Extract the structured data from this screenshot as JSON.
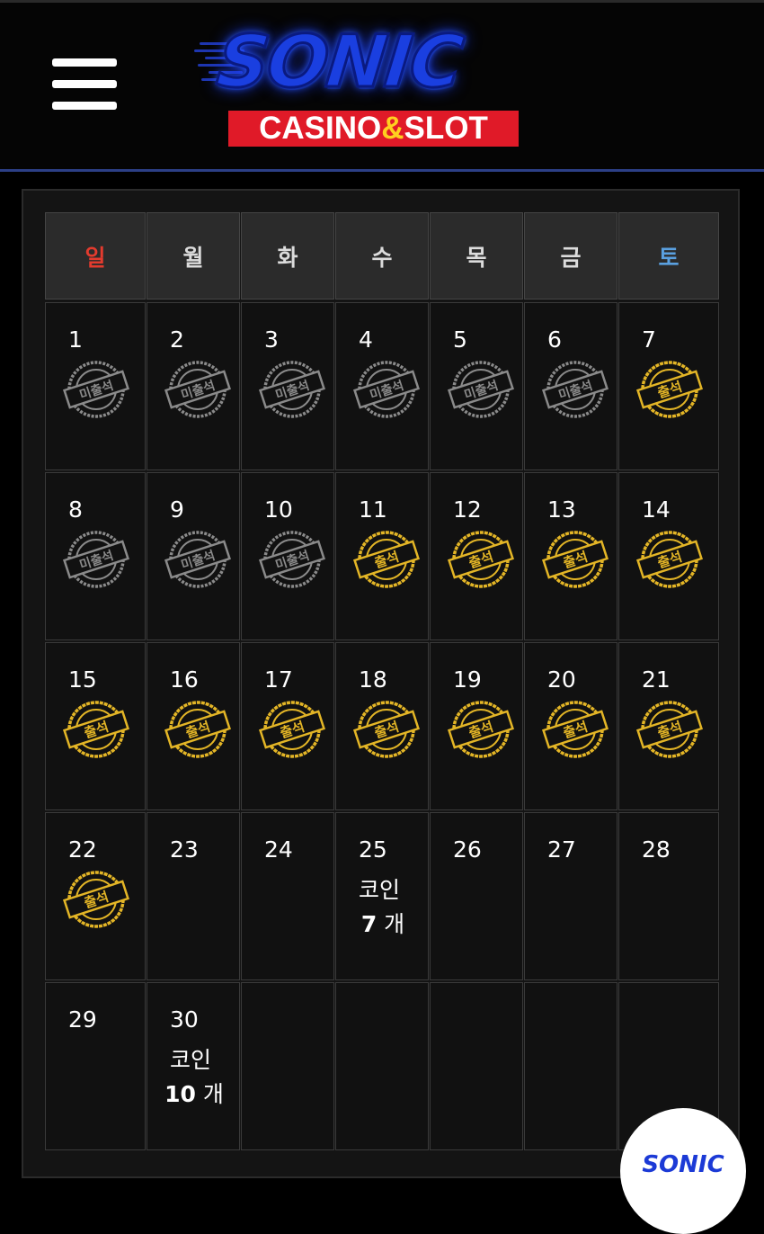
{
  "header": {
    "logo_title": "SONIC",
    "logo_sub_left": "CASINO",
    "logo_sub_amp": "&",
    "logo_sub_right": "SLOT"
  },
  "calendar": {
    "weekdays": [
      "일",
      "월",
      "화",
      "수",
      "목",
      "금",
      "토"
    ],
    "weeks": [
      [
        {
          "day": "1",
          "stamp": "미출석"
        },
        {
          "day": "2",
          "stamp": "미출석"
        },
        {
          "day": "3",
          "stamp": "미출석"
        },
        {
          "day": "4",
          "stamp": "미출석"
        },
        {
          "day": "5",
          "stamp": "미출석"
        },
        {
          "day": "6",
          "stamp": "미출석"
        },
        {
          "day": "7",
          "stamp": "출석"
        }
      ],
      [
        {
          "day": "8",
          "stamp": "미출석"
        },
        {
          "day": "9",
          "stamp": "미출석"
        },
        {
          "day": "10",
          "stamp": "미출석"
        },
        {
          "day": "11",
          "stamp": "출석"
        },
        {
          "day": "12",
          "stamp": "출석"
        },
        {
          "day": "13",
          "stamp": "출석"
        },
        {
          "day": "14",
          "stamp": "출석"
        }
      ],
      [
        {
          "day": "15",
          "stamp": "출석"
        },
        {
          "day": "16",
          "stamp": "출석"
        },
        {
          "day": "17",
          "stamp": "출석"
        },
        {
          "day": "18",
          "stamp": "출석"
        },
        {
          "day": "19",
          "stamp": "출석"
        },
        {
          "day": "20",
          "stamp": "출석"
        },
        {
          "day": "21",
          "stamp": "출석"
        }
      ],
      [
        {
          "day": "22",
          "stamp": "출석"
        },
        {
          "day": "23"
        },
        {
          "day": "24"
        },
        {
          "day": "25",
          "coin_label": "코인",
          "coin_count": "7",
          "coin_unit": "개"
        },
        {
          "day": "26"
        },
        {
          "day": "27"
        },
        {
          "day": "28"
        }
      ],
      [
        {
          "day": "29"
        },
        {
          "day": "30",
          "coin_label": "코인",
          "coin_count": "10",
          "coin_unit": "개"
        },
        {
          "day": ""
        },
        {
          "day": ""
        },
        {
          "day": ""
        },
        {
          "day": ""
        },
        {
          "day": ""
        }
      ]
    ]
  },
  "fab": {
    "label": "SONIC"
  },
  "colors": {
    "attended": "#e3b526",
    "absent": "#8a8a8a",
    "sunday": "#e33b2e",
    "saturday": "#5aa0e0",
    "logo_blue": "#1a3fe0",
    "logo_red": "#e01a28"
  },
  "icons": {
    "menu": "hamburger-menu-icon",
    "attended": "attended-stamp-icon",
    "absent": "absent-stamp-icon"
  }
}
